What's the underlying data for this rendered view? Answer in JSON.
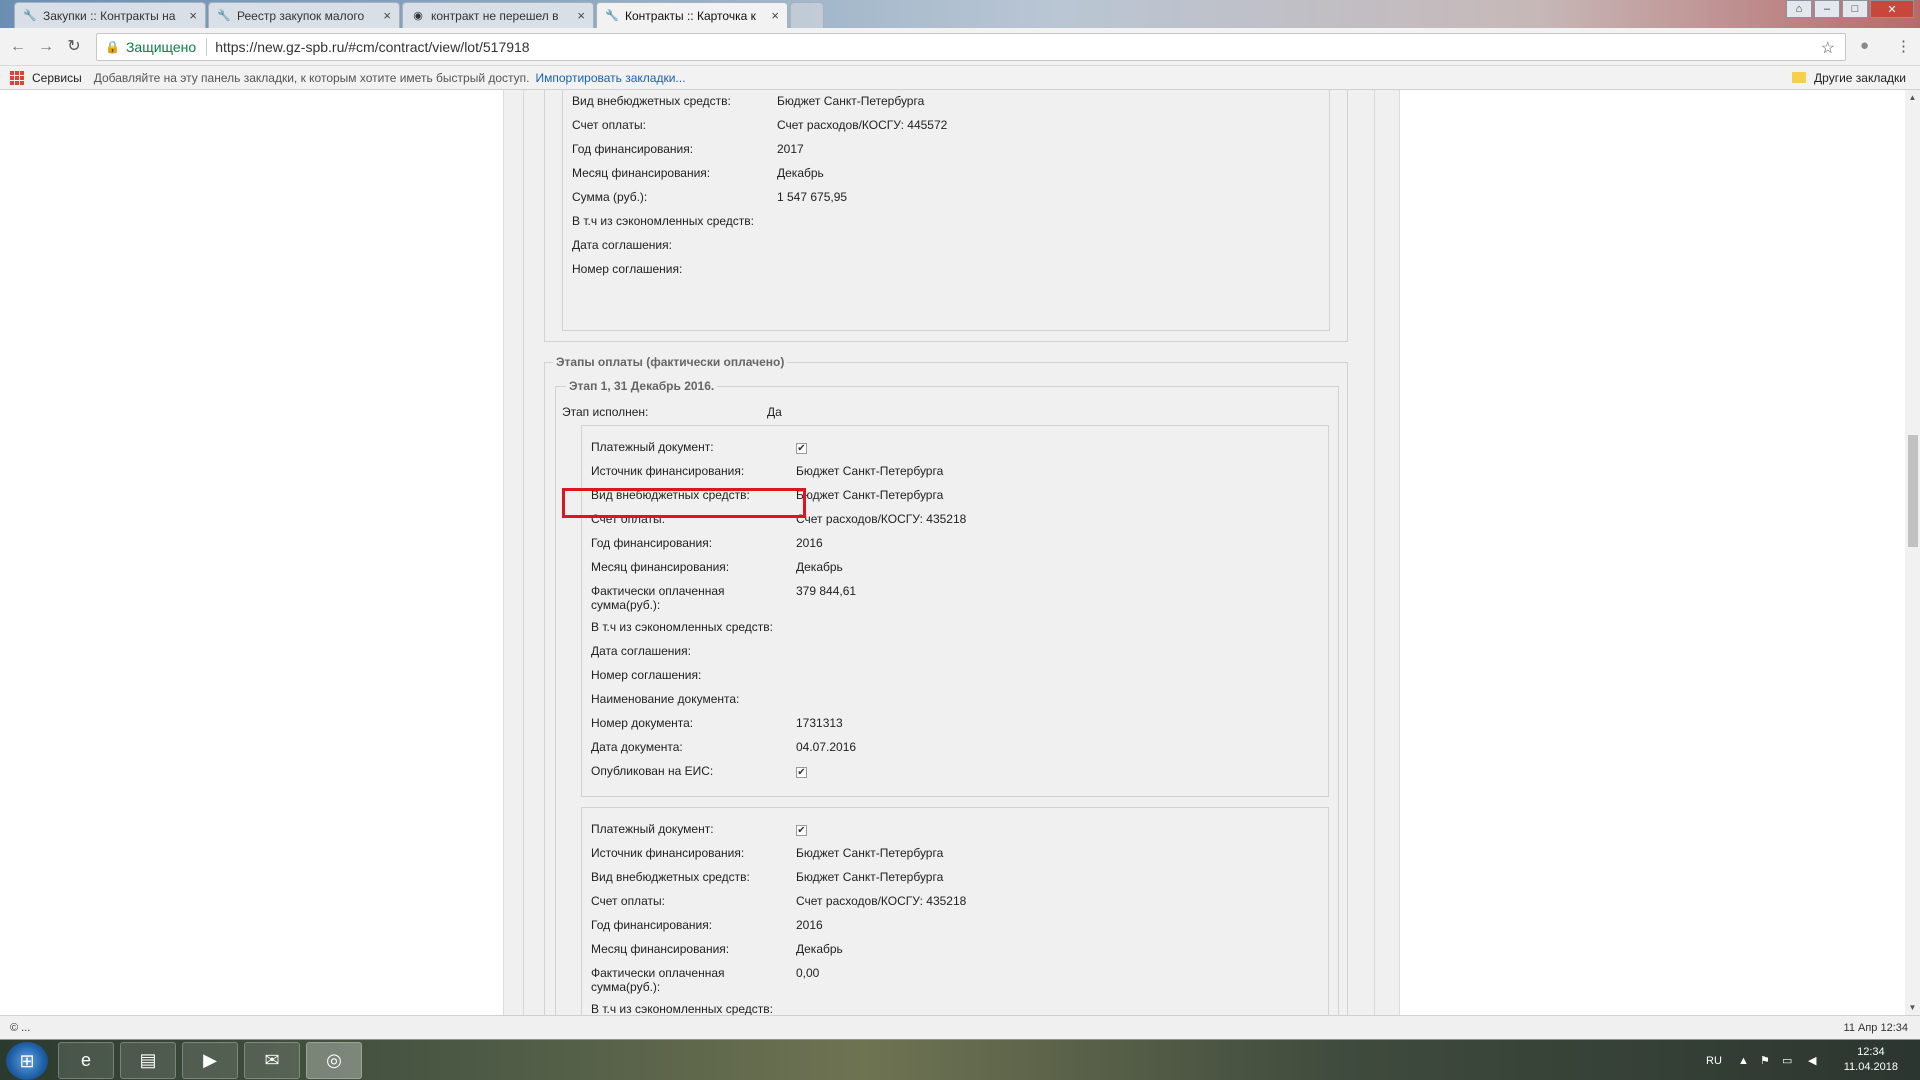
{
  "browser": {
    "tabs": [
      {
        "title": "Закупки :: Контракты на",
        "icon": "gz-logo-icon",
        "active": false
      },
      {
        "title": "Реестр закупок малого",
        "icon": "gz-logo-icon",
        "active": false
      },
      {
        "title": "контракт не перешел в",
        "icon": "web-globe-icon",
        "active": false
      },
      {
        "title": "Контракты :: Карточка к",
        "icon": "gz-logo-icon",
        "active": true
      }
    ],
    "secure_label": "Защищено",
    "url": "https://new.gz-spb.ru/#cm/contract/view/lot/517918",
    "bookmarks": {
      "services": "Сервисы",
      "hint": "Добавляйте на эту панель закладки, к которым хотите иметь быстрый доступ.",
      "import": "Импортировать закладки...",
      "other": "Другие закладки"
    }
  },
  "page": {
    "plan_rows": [
      {
        "label": "Вид внебюджетных средств:",
        "value": "Бюджет Санкт-Петербурга"
      },
      {
        "label": "Счет оплаты:",
        "value": "Счет расходов/КОСГУ: 445572"
      },
      {
        "label": "Год финансирования:",
        "value": "2017"
      },
      {
        "label": "Месяц финансирования:",
        "value": "Декабрь"
      },
      {
        "label": "Сумма (руб.):",
        "value": "1 547 675,95"
      },
      {
        "label": "В т.ч из сэкономленных средств:",
        "value": ""
      },
      {
        "label": "Дата соглашения:",
        "value": ""
      },
      {
        "label": "Номер соглашения:",
        "value": ""
      }
    ],
    "paid_section_title": "Этапы оплаты (фактически оплачено)",
    "stage_title": "Этап 1, 31 Декабрь 2016.",
    "stage_done_label": "Этап исполнен:",
    "stage_done_value": "Да",
    "payment1": [
      {
        "label": "Платежный документ:",
        "value": "",
        "check": true
      },
      {
        "label": "Источник финансирования:",
        "value": "Бюджет Санкт-Петербурга"
      },
      {
        "label": "Вид внебюджетных средств:",
        "value": "Бюджет Санкт-Петербурга"
      },
      {
        "label": "Счет оплаты:",
        "value": "Счет расходов/КОСГУ: 435218"
      },
      {
        "label": "Год финансирования:",
        "value": "2016"
      },
      {
        "label": "Месяц финансирования:",
        "value": "Декабрь"
      },
      {
        "label": "Фактически оплаченная сумма(руб.):",
        "value": "379 844,61"
      },
      {
        "label": "В т.ч из сэкономленных средств:",
        "value": ""
      },
      {
        "label": "Дата соглашения:",
        "value": ""
      },
      {
        "label": "Номер соглашения:",
        "value": ""
      },
      {
        "label": "Наименование документа:",
        "value": ""
      },
      {
        "label": "Номер документа:",
        "value": "1731313"
      },
      {
        "label": "Дата документа:",
        "value": "04.07.2016"
      },
      {
        "label": "Опубликован на ЕИС:",
        "value": "",
        "check": true
      }
    ],
    "payment2": [
      {
        "label": "Платежный документ:",
        "value": "",
        "check": true
      },
      {
        "label": "Источник финансирования:",
        "value": "Бюджет Санкт-Петербурга"
      },
      {
        "label": "Вид внебюджетных средств:",
        "value": "Бюджет Санкт-Петербурга"
      },
      {
        "label": "Счет оплаты:",
        "value": "Счет расходов/КОСГУ: 435218"
      },
      {
        "label": "Год финансирования:",
        "value": "2016"
      },
      {
        "label": "Месяц финансирования:",
        "value": "Декабрь"
      },
      {
        "label": "Фактически оплаченная сумма(руб.):",
        "value": "0,00"
      },
      {
        "label": "В т.ч из сэкономленных средств:",
        "value": ""
      }
    ],
    "checkmark": "✔"
  },
  "status": {
    "left": "© ...",
    "right": "11 Апр 12:34"
  },
  "taskbar": {
    "lang": "RU",
    "time": "12:34",
    "date": "11.04.2018"
  }
}
